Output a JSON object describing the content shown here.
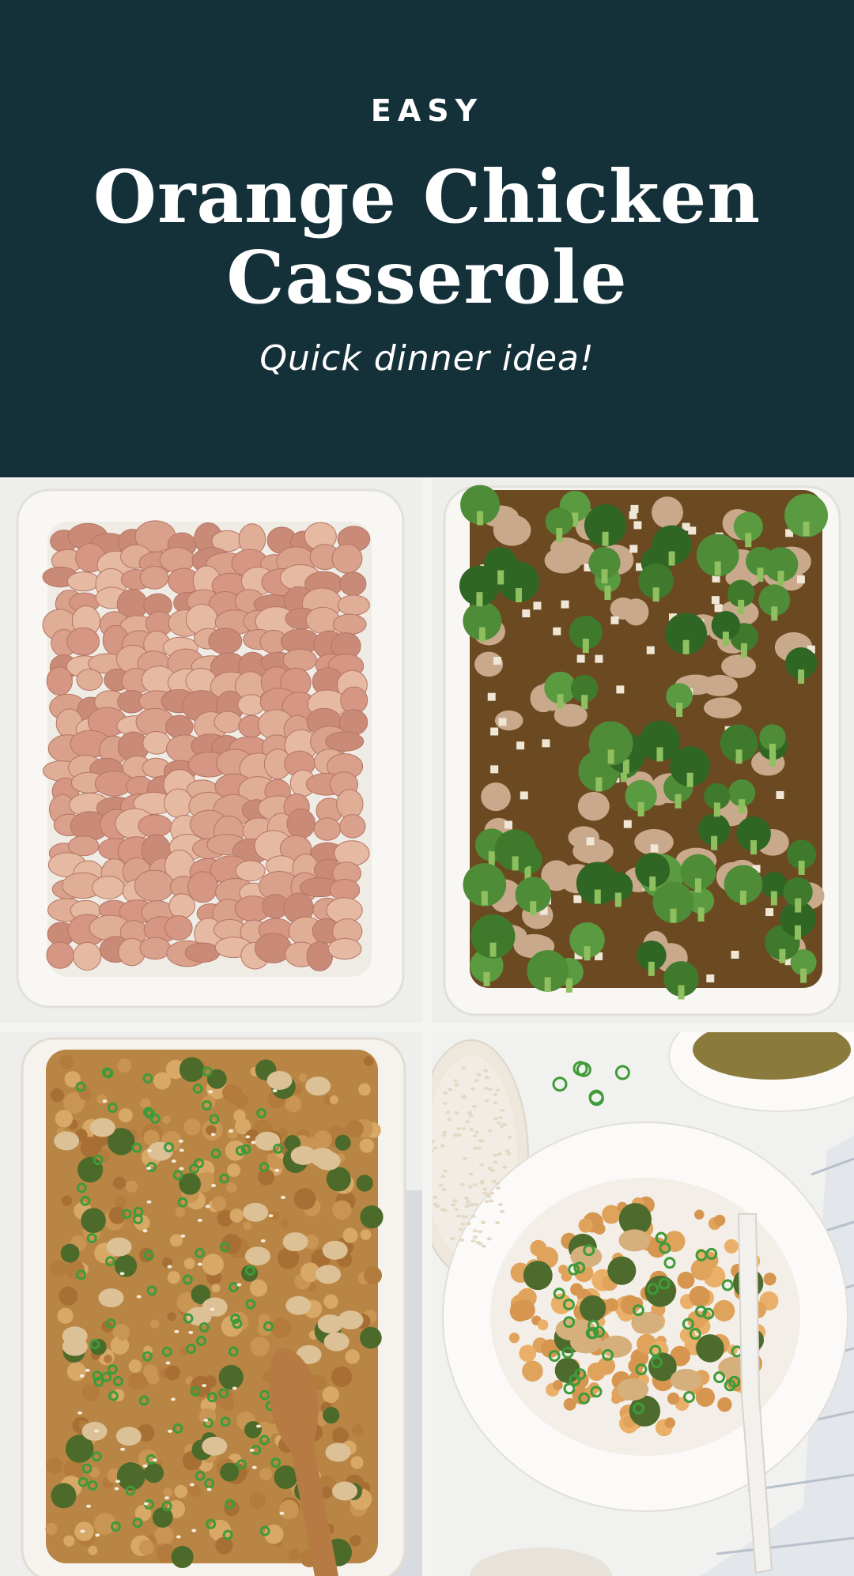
{
  "header": {
    "kicker": "EASY",
    "title_line1": "Orange Chicken",
    "title_line2": "Casserole",
    "subtitle": "Quick dinner idea!"
  },
  "colors": {
    "header_bg": "#14313a",
    "header_text": "#ffffff",
    "dish_white": "#f7f5f1",
    "raw_chicken": "#d9a08c",
    "broccoli": "#3f7a2c",
    "sauce": "#6b4a22",
    "baked": "#c99552",
    "green_onion": "#3f9b3a"
  },
  "photos": [
    {
      "id": "raw-chicken-in-dish",
      "icon": "raw-chicken-photo"
    },
    {
      "id": "chicken-broccoli-broth-in-dish",
      "icon": "unbaked-casserole-photo"
    },
    {
      "id": "baked-casserole-with-spoon",
      "icon": "baked-casserole-photo"
    },
    {
      "id": "served-bowl-with-fork",
      "icon": "served-bowl-photo"
    }
  ]
}
